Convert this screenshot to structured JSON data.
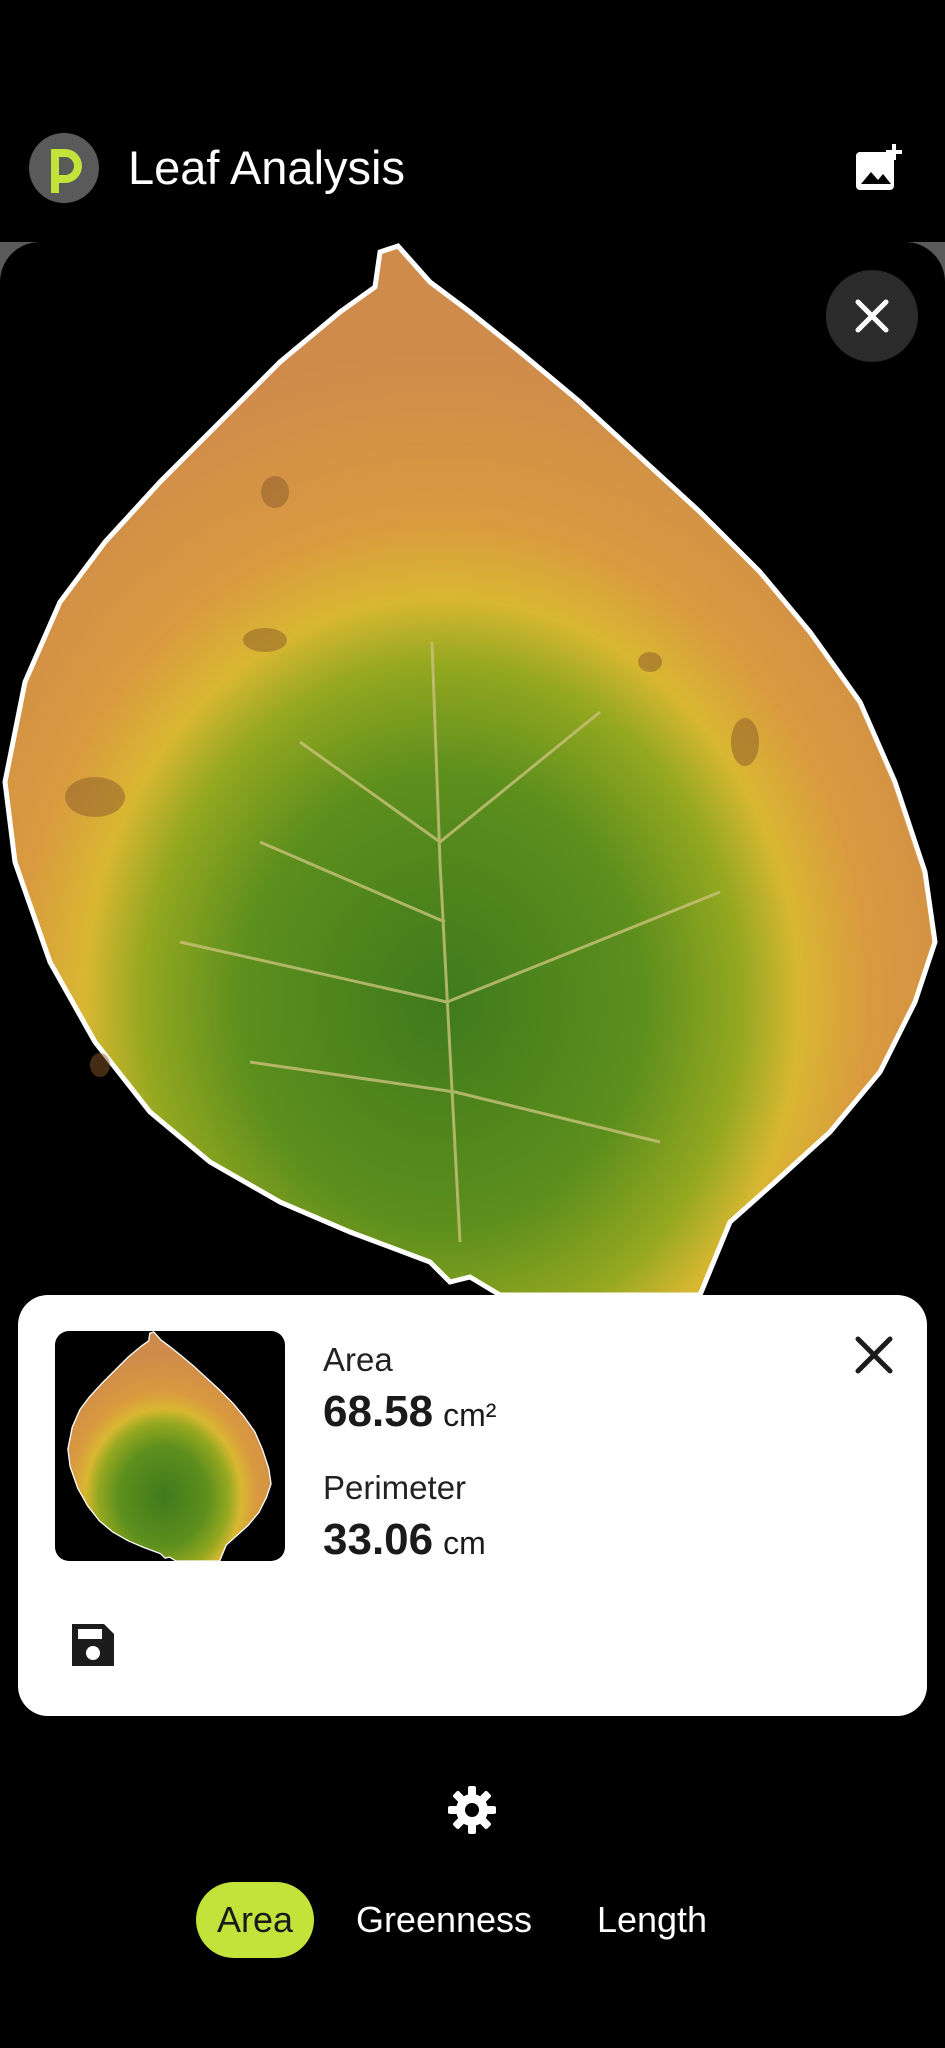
{
  "app_bar": {
    "title": "Leaf Analysis",
    "logo_icon": "leaf-logo-icon",
    "action_icon": "add-photo-icon"
  },
  "photo": {
    "close_icon": "close-icon"
  },
  "result_card": {
    "area_label": "Area",
    "area_value": "68.58",
    "area_unit": "cm²",
    "perimeter_label": "Perimeter",
    "perimeter_value": "33.06",
    "perimeter_unit": "cm",
    "close_icon": "close-icon",
    "save_icon": "save-icon"
  },
  "settings_icon": "gear-icon",
  "modes": {
    "tabs": [
      "Area",
      "Greenness",
      "Length"
    ],
    "selected": "Area"
  },
  "colors": {
    "accent": "#c3e23a",
    "background": "#000000",
    "card": "#ffffff"
  }
}
